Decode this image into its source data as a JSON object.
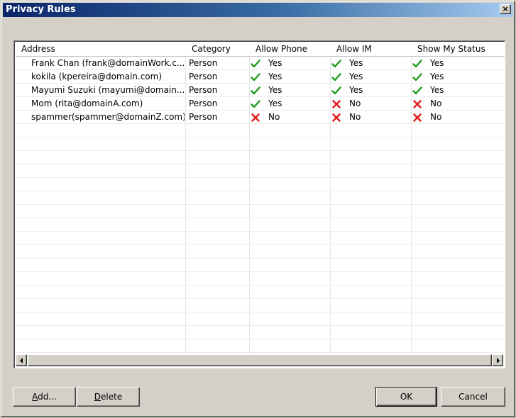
{
  "window": {
    "title": "Privacy Rules",
    "close_label": "×"
  },
  "columns": [
    {
      "label": "Address"
    },
    {
      "label": "Category"
    },
    {
      "label": "Allow Phone"
    },
    {
      "label": "Allow IM"
    },
    {
      "label": "Show My Status"
    }
  ],
  "rows": [
    {
      "address": "Frank Chan (frank@domainWork.c...",
      "category": "Person",
      "phone": {
        "value": "Yes",
        "icon": "check-icon"
      },
      "im": {
        "value": "Yes",
        "icon": "check-icon"
      },
      "status": {
        "value": "Yes",
        "icon": "check-icon"
      }
    },
    {
      "address": "kokila (kpereira@domain.com)",
      "category": "Person",
      "phone": {
        "value": "Yes",
        "icon": "check-icon"
      },
      "im": {
        "value": "Yes",
        "icon": "check-icon"
      },
      "status": {
        "value": "Yes",
        "icon": "check-icon"
      }
    },
    {
      "address": "Mayumi Suzuki (mayumi@domain...",
      "category": "Person",
      "phone": {
        "value": "Yes",
        "icon": "check-icon"
      },
      "im": {
        "value": "Yes",
        "icon": "check-icon"
      },
      "status": {
        "value": "Yes",
        "icon": "check-icon"
      }
    },
    {
      "address": "Mom (rita@domainA.com)",
      "category": "Person",
      "phone": {
        "value": "Yes",
        "icon": "check-icon"
      },
      "im": {
        "value": "No",
        "icon": "cross-icon"
      },
      "status": {
        "value": "No",
        "icon": "cross-icon"
      }
    },
    {
      "address": "spammer(spammer@domainZ.com)",
      "category": "Person",
      "phone": {
        "value": "No",
        "icon": "cross-icon"
      },
      "im": {
        "value": "No",
        "icon": "cross-icon"
      },
      "status": {
        "value": "No",
        "icon": "cross-icon"
      }
    }
  ],
  "buttons": {
    "add": {
      "label_underlined": "A",
      "label_rest": "dd..."
    },
    "delete": {
      "label_underlined": "D",
      "label_rest": "elete"
    },
    "ok": "OK",
    "cancel": "Cancel"
  },
  "colors": {
    "check": "#1e9a1e",
    "cross": "#e02020",
    "title_start": "#0a246a",
    "title_end": "#a6caf0",
    "dialog_bg": "#d4d0c8"
  }
}
